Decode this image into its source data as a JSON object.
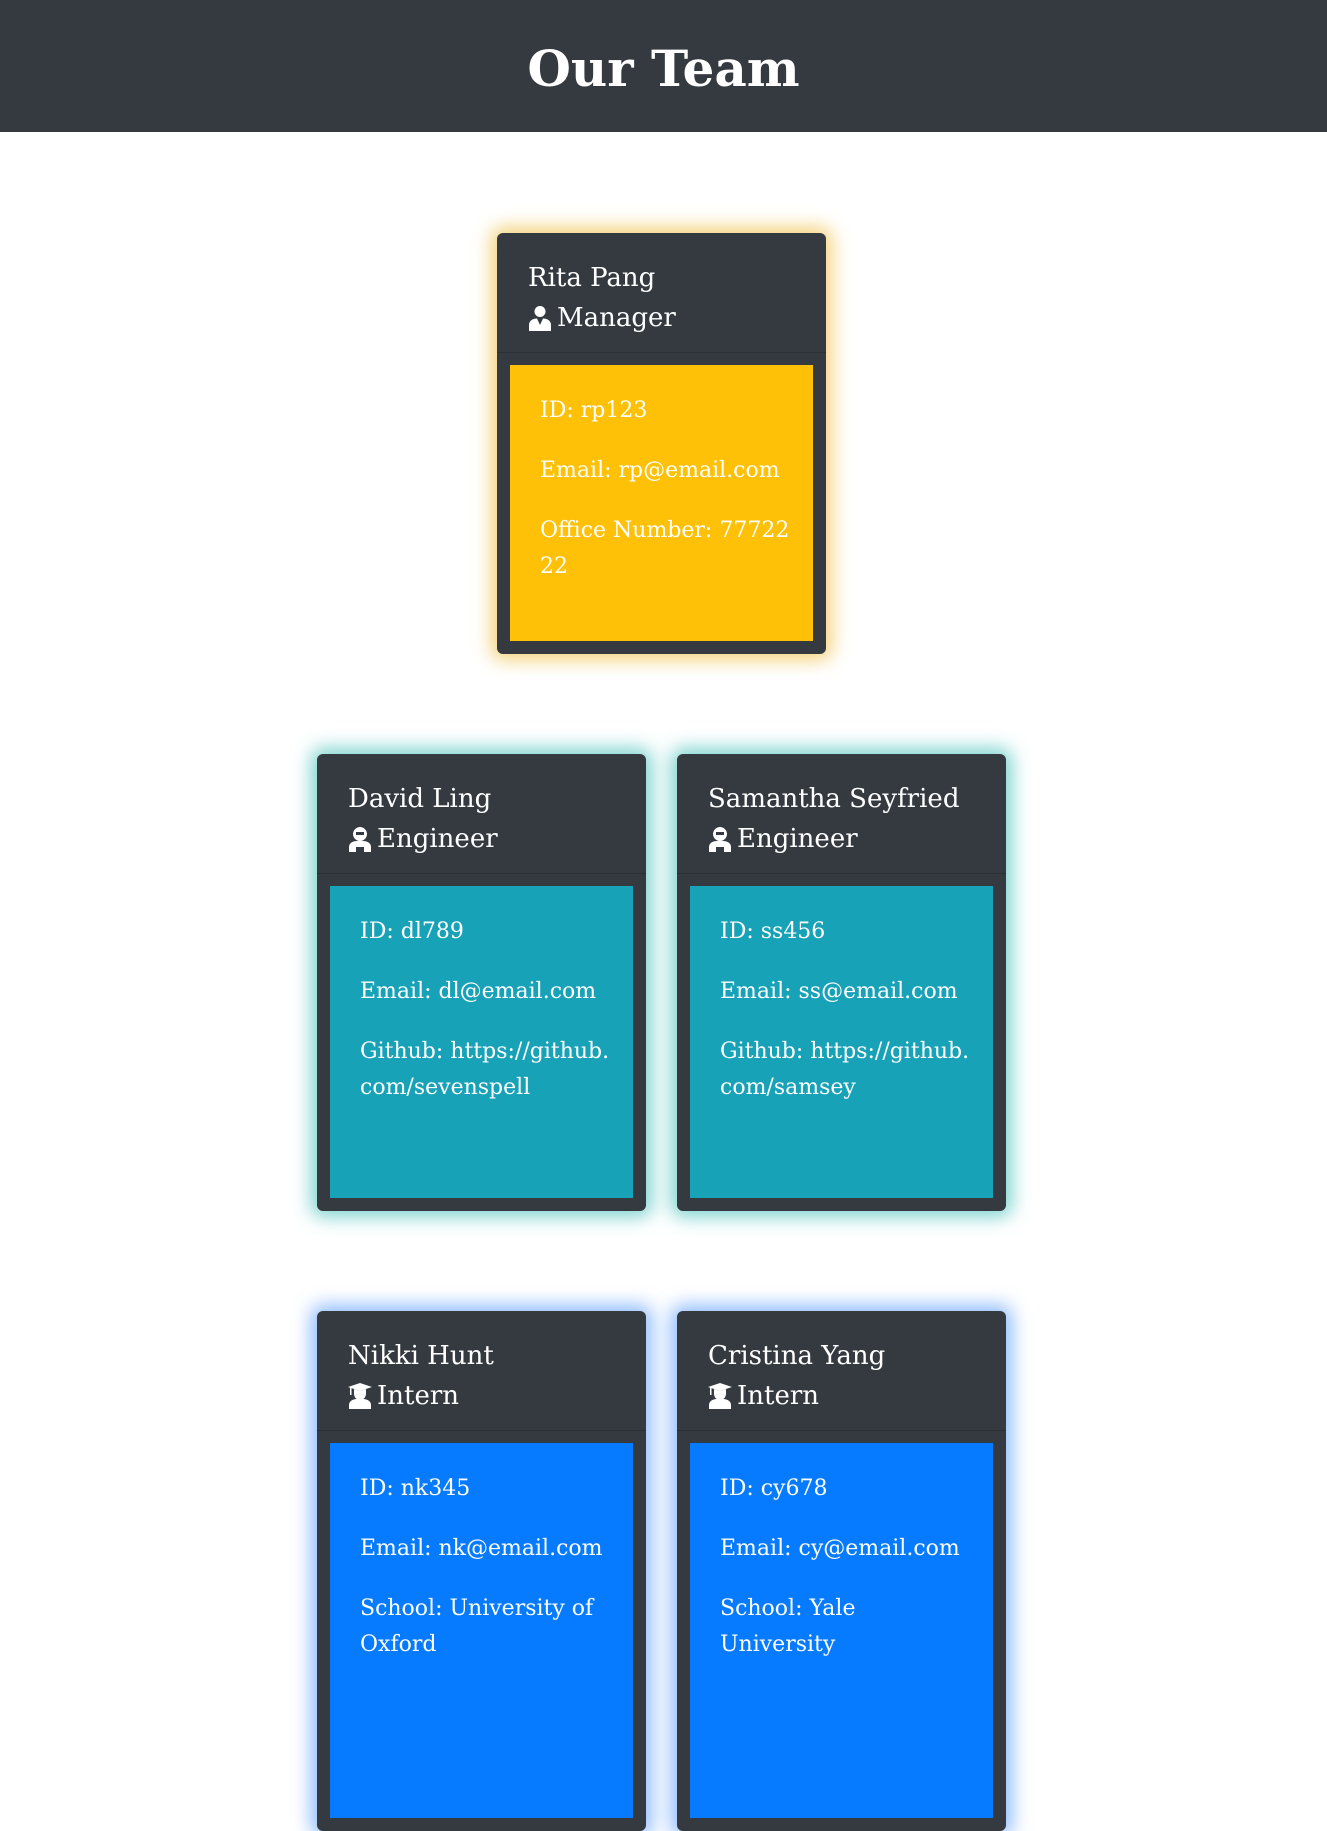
{
  "header": {
    "title": "Our Team"
  },
  "manager": {
    "name": "Rita Pang",
    "role": "Manager",
    "icon": "manager-icon",
    "id": "ID: rp123",
    "email": "Email: rp@email.com",
    "extra": "Office Number: 7772222"
  },
  "engineers": [
    {
      "name": "David Ling",
      "role": "Engineer",
      "icon": "engineer-icon",
      "id": "ID: dl789",
      "email": "Email: dl@email.com",
      "extra": "Github: https://github.com/sevenspell"
    },
    {
      "name": "Samantha Seyfried",
      "role": "Engineer",
      "icon": "engineer-icon",
      "id": "ID: ss456",
      "email": "Email: ss@email.com",
      "extra": "Github: https://github.com/samsey"
    }
  ],
  "interns": [
    {
      "name": "Nikki Hunt",
      "role": "Intern",
      "icon": "graduate-icon",
      "id": "ID: nk345",
      "email": "Email: nk@email.com",
      "extra": "School: University of Oxford"
    },
    {
      "name": "Cristina Yang",
      "role": "Intern",
      "icon": "graduate-icon",
      "id": "ID: cy678",
      "email": "Email: cy@email.com",
      "extra": "School: Yale University"
    }
  ],
  "colors": {
    "manager": "#fec107",
    "engineer": "#17a2b8",
    "intern": "#077bff",
    "card": "#343a40"
  }
}
